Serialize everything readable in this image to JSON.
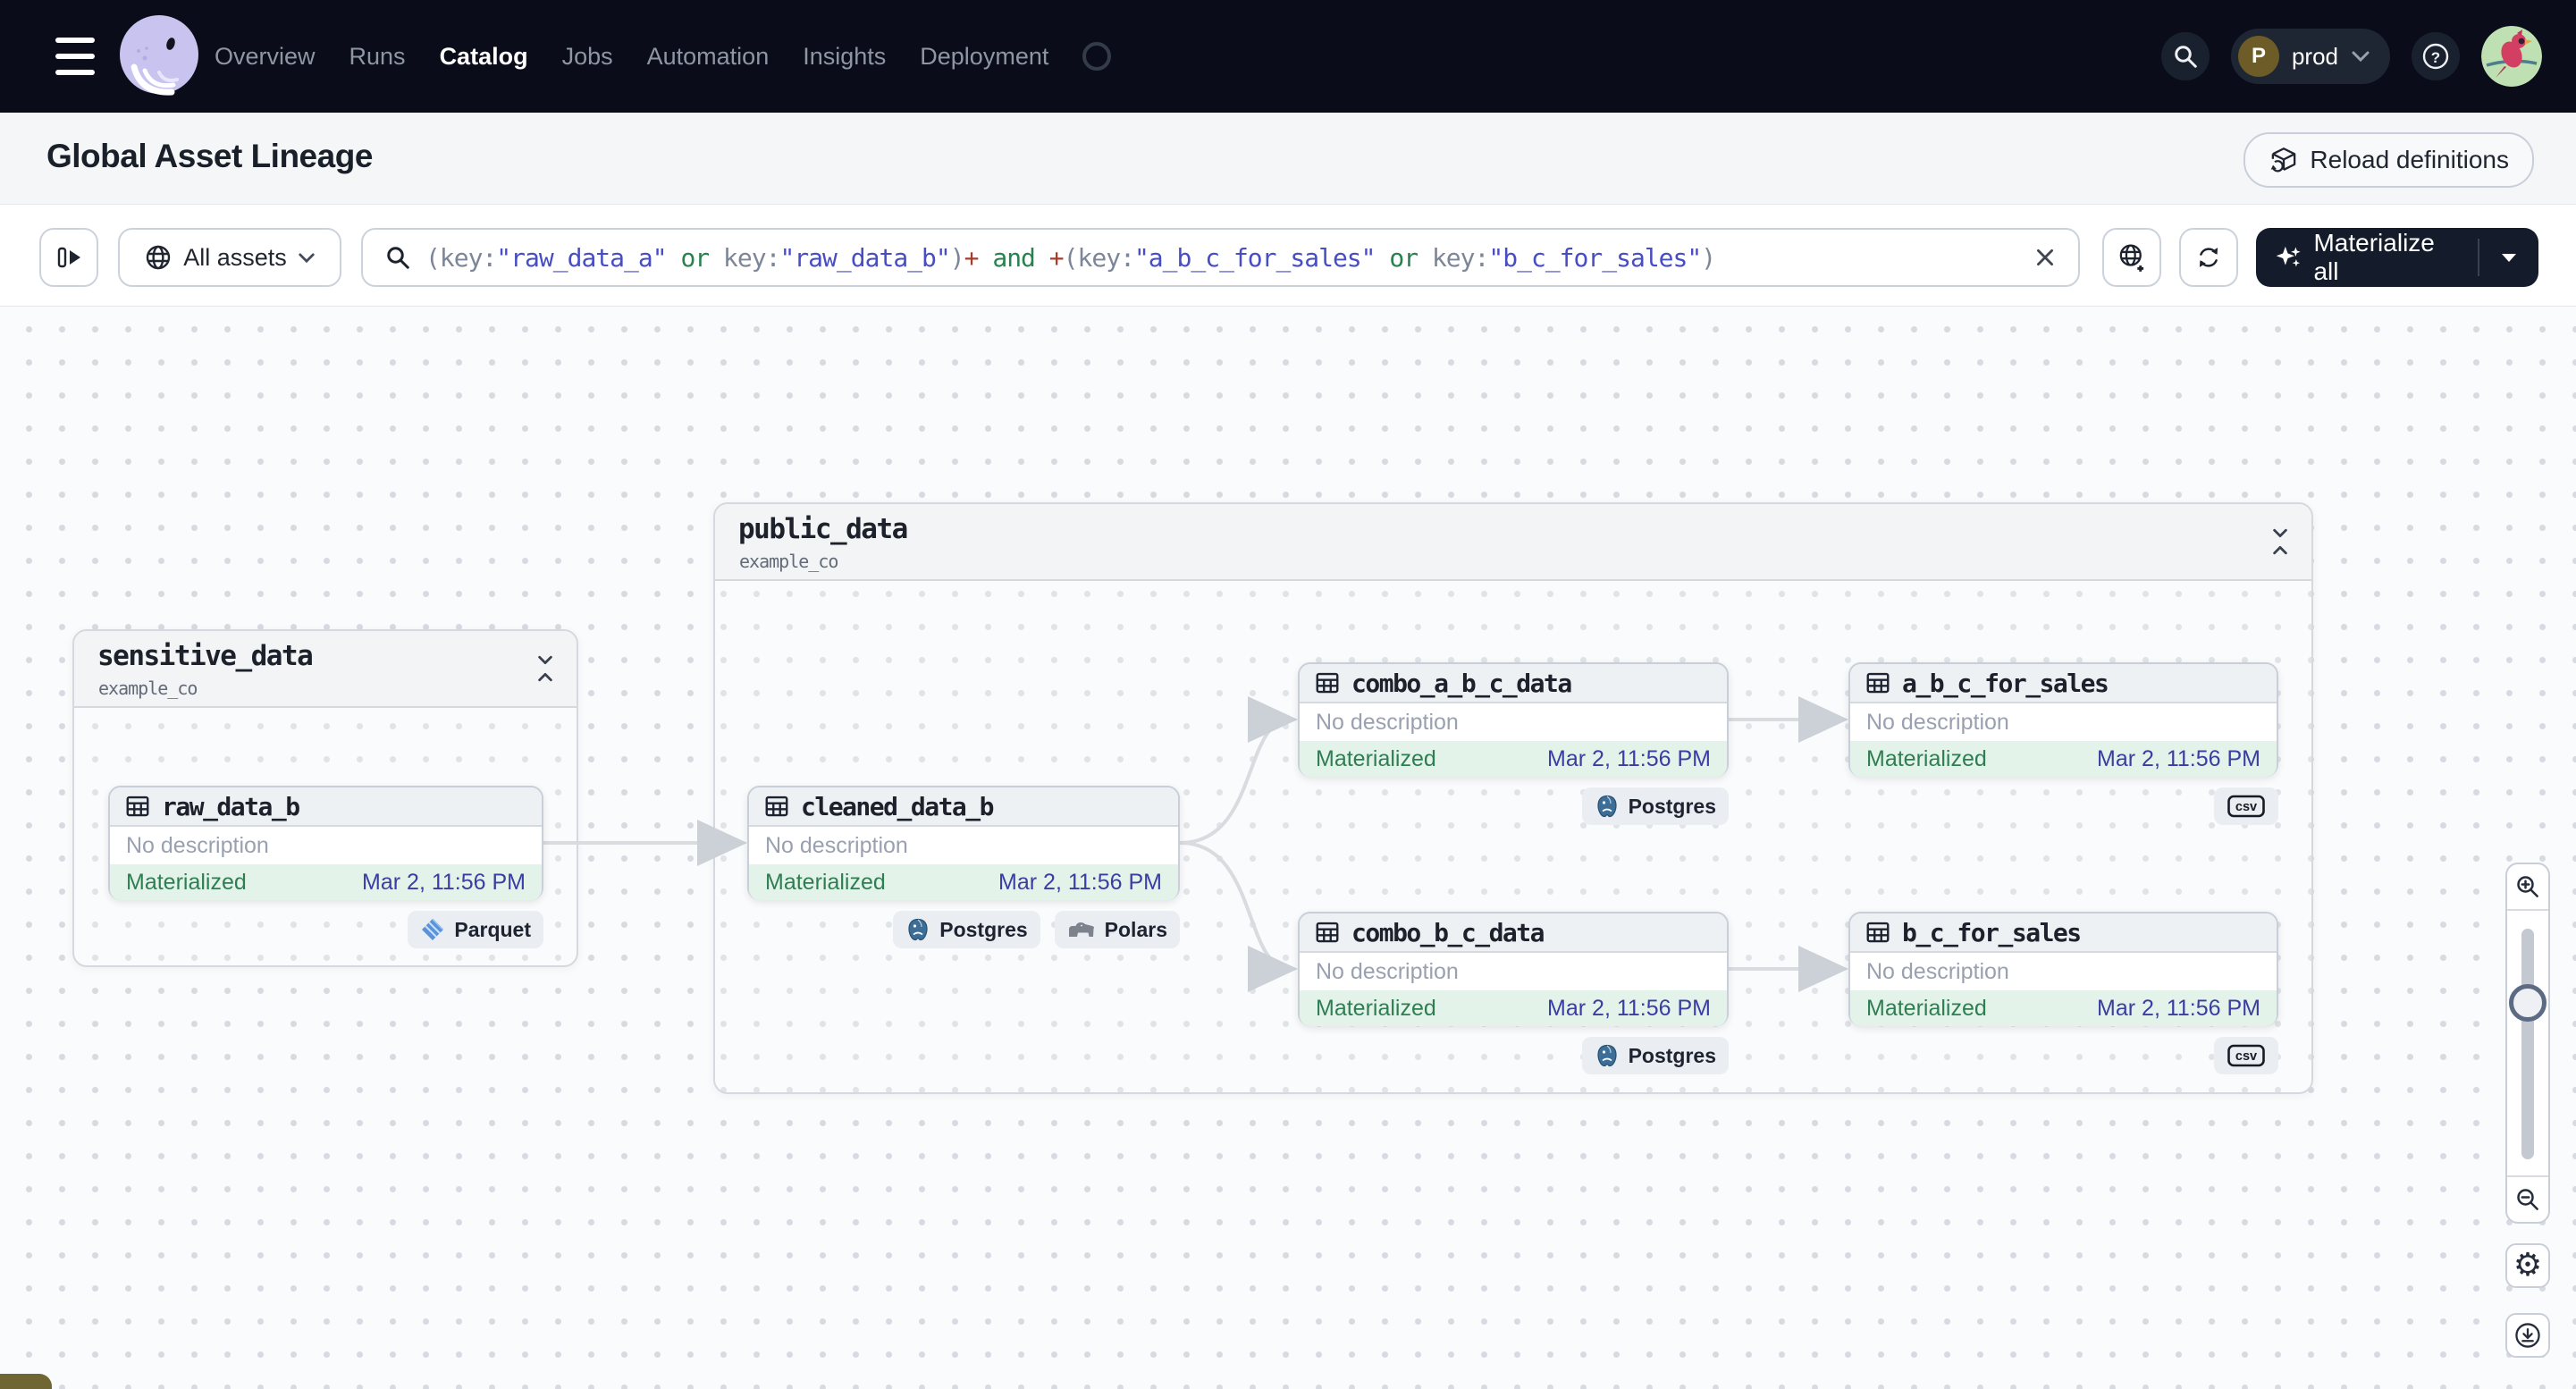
{
  "nav": {
    "items": [
      {
        "label": "Overview",
        "active": false
      },
      {
        "label": "Runs",
        "active": false
      },
      {
        "label": "Catalog",
        "active": true
      },
      {
        "label": "Jobs",
        "active": false
      },
      {
        "label": "Automation",
        "active": false
      },
      {
        "label": "Insights",
        "active": false
      },
      {
        "label": "Deployment",
        "active": false
      }
    ],
    "environment": {
      "initial": "P",
      "name": "prod"
    }
  },
  "header": {
    "title": "Global Asset Lineage",
    "reload_button_label": "Reload definitions"
  },
  "toolbar": {
    "scope_button_label": "All assets",
    "materialize_button_label": "Materialize all",
    "query_tokens": [
      {
        "text": "(key:",
        "style": "punct"
      },
      {
        "text": "\"raw_data_a\"",
        "style": "value"
      },
      {
        "text": " or ",
        "style": "op"
      },
      {
        "text": "key:",
        "style": "punct"
      },
      {
        "text": "\"raw_data_b\"",
        "style": "value"
      },
      {
        "text": ")",
        "style": "punct"
      },
      {
        "text": "+",
        "style": "plus"
      },
      {
        "text": " and ",
        "style": "op"
      },
      {
        "text": "+",
        "style": "plus"
      },
      {
        "text": "(key:",
        "style": "punct"
      },
      {
        "text": "\"a_b_c_for_sales\"",
        "style": "value"
      },
      {
        "text": " or ",
        "style": "op"
      },
      {
        "text": "key:",
        "style": "punct"
      },
      {
        "text": "\"b_c_for_sales\"",
        "style": "value"
      },
      {
        "text": ")",
        "style": "punct"
      }
    ]
  },
  "graph": {
    "groups": [
      {
        "id": "sensitive_data",
        "name": "sensitive_data",
        "location": "example_co"
      },
      {
        "id": "public_data",
        "name": "public_data",
        "location": "example_co"
      }
    ],
    "assets": [
      {
        "id": "raw_data_b",
        "name": "raw_data_b",
        "description": "No description",
        "status": "Materialized",
        "last_materialized": "Mar 2, 11:56 PM",
        "tags": [
          {
            "icon": "parquet",
            "label": "Parquet"
          }
        ]
      },
      {
        "id": "cleaned_data_b",
        "name": "cleaned_data_b",
        "description": "No description",
        "status": "Materialized",
        "last_materialized": "Mar 2, 11:56 PM",
        "tags": [
          {
            "icon": "postgres",
            "label": "Postgres"
          },
          {
            "icon": "polars",
            "label": "Polars"
          }
        ]
      },
      {
        "id": "combo_a_b_c_data",
        "name": "combo_a_b_c_data",
        "description": "No description",
        "status": "Materialized",
        "last_materialized": "Mar 2, 11:56 PM",
        "tags": [
          {
            "icon": "postgres",
            "label": "Postgres"
          }
        ]
      },
      {
        "id": "a_b_c_for_sales",
        "name": "a_b_c_for_sales",
        "description": "No description",
        "status": "Materialized",
        "last_materialized": "Mar 2, 11:56 PM",
        "tags": [
          {
            "icon": "csv",
            "label": ""
          }
        ]
      },
      {
        "id": "combo_b_c_data",
        "name": "combo_b_c_data",
        "description": "No description",
        "status": "Materialized",
        "last_materialized": "Mar 2, 11:56 PM",
        "tags": [
          {
            "icon": "postgres",
            "label": "Postgres"
          }
        ]
      },
      {
        "id": "b_c_for_sales",
        "name": "b_c_for_sales",
        "description": "No description",
        "status": "Materialized",
        "last_materialized": "Mar 2, 11:56 PM",
        "tags": [
          {
            "icon": "csv",
            "label": ""
          }
        ]
      }
    ],
    "edges": [
      {
        "from": "raw_data_b",
        "to": "cleaned_data_b"
      },
      {
        "from": "cleaned_data_b",
        "to": "combo_a_b_c_data"
      },
      {
        "from": "cleaned_data_b",
        "to": "combo_b_c_data"
      },
      {
        "from": "combo_a_b_c_data",
        "to": "a_b_c_for_sales"
      },
      {
        "from": "combo_b_c_data",
        "to": "b_c_for_sales"
      }
    ]
  },
  "canvas_controls": {
    "buttons": [
      "zoom-in",
      "zoom-out",
      "settings",
      "download"
    ]
  },
  "colors": {
    "nav_background": "#0a0d19",
    "accent_indigo": "#474dc3",
    "query_green": "#2a8150",
    "query_maroon": "#a23e2e",
    "materialized_text": "#2f7e52",
    "materialized_background": "#e3f3ea",
    "timestamp_blue": "#3a3da1",
    "dark_button": "#141b2b"
  }
}
